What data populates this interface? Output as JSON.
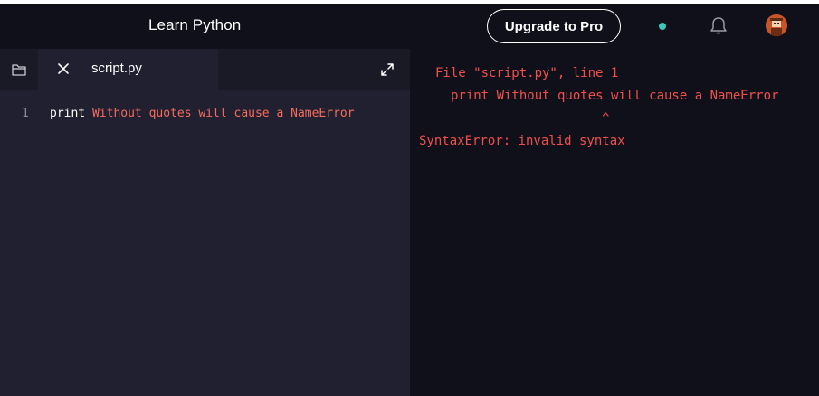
{
  "header": {
    "title": "Learn Python",
    "upgrade_label": "Upgrade to Pro"
  },
  "editor": {
    "tab_label": "script.py",
    "line_number": "1",
    "code_keyword": "print",
    "code_rest": " Without quotes will cause a NameError"
  },
  "console": {
    "line1": "File \"script.py\", line 1",
    "line2": "print Without quotes will cause a NameError",
    "line3": "^",
    "line4": "SyntaxError: invalid syntax"
  },
  "colors": {
    "error": "#f0504d",
    "string": "#f36c5c",
    "status_dot": "#3ec6b8",
    "avatar": "#c8542a"
  }
}
